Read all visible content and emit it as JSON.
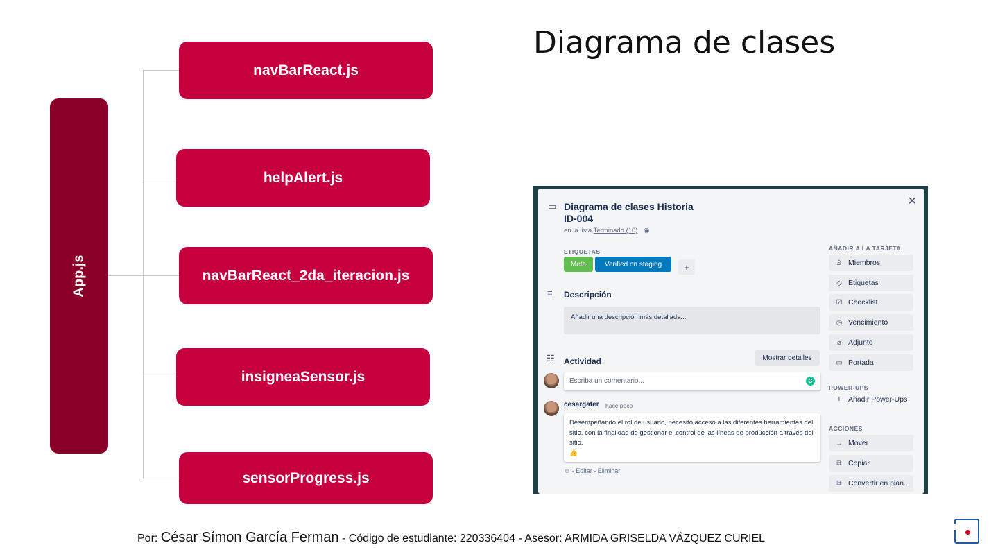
{
  "slide": {
    "title": "Diagrama de clases",
    "root": "App.js",
    "components": [
      "navBarReact.js",
      "helpAlert.js",
      "navBarReact_2da_iteracion.js",
      "insigneaSensor.js",
      "sensorProgress.js"
    ],
    "footer": {
      "prefix": "Por: ",
      "author": "César Símon García Ferman",
      "rest": " - Código de estudiante: 220336404 - Asesor: ARMIDA GRISELDA VÁZQUEZ CURIEL"
    }
  },
  "card": {
    "title_line1": "Diagrama de clases Historia",
    "title_line2": "ID-004",
    "in_list_prefix": "en la lista ",
    "list_name": "Terminado (10)",
    "labels_heading": "ETIQUETAS",
    "labels": [
      {
        "text": "Meta",
        "color": "#61bd4f"
      },
      {
        "text": "Verified on staging",
        "color": "#0079bf"
      }
    ],
    "add_label": "+",
    "description_heading": "Descripción",
    "description_placeholder": "Añadir una descripción más detallada...",
    "activity_heading": "Actividad",
    "show_details": "Mostrar detalles",
    "comment_placeholder": "Escriba un comentario...",
    "comment": {
      "user": "cesargafer",
      "time": "hace poco",
      "text": "Desempeñando el rol de usuario, necesito acceso a las diferentes herramientas del sitio, con la finalidad de gestionar el control de las líneas de producción a través del sitio.",
      "emoji": "👍",
      "edit": "Editar",
      "delete": "Eliminar"
    },
    "add_to_card_heading": "AÑADIR A LA TARJETA",
    "add_to_card": [
      {
        "label": "Miembros",
        "icon": "user-icon"
      },
      {
        "label": "Etiquetas",
        "icon": "tag-icon"
      },
      {
        "label": "Checklist",
        "icon": "checklist-icon"
      },
      {
        "label": "Vencimiento",
        "icon": "clock-icon"
      },
      {
        "label": "Adjunto",
        "icon": "paperclip-icon"
      },
      {
        "label": "Portada",
        "icon": "cover-icon"
      }
    ],
    "powerups_heading": "POWER-UPS",
    "add_powerups": "Añadir Power-Ups",
    "actions_heading": "ACCIONES",
    "actions": [
      {
        "label": "Mover",
        "icon": "arrow-right-icon"
      },
      {
        "label": "Copiar",
        "icon": "copy-icon"
      },
      {
        "label": "Convertir en plan...",
        "icon": "template-icon"
      }
    ]
  },
  "colors": {
    "root_box": "#8b0029",
    "component_box": "#c6003f",
    "connector": "#c8c8c8"
  }
}
